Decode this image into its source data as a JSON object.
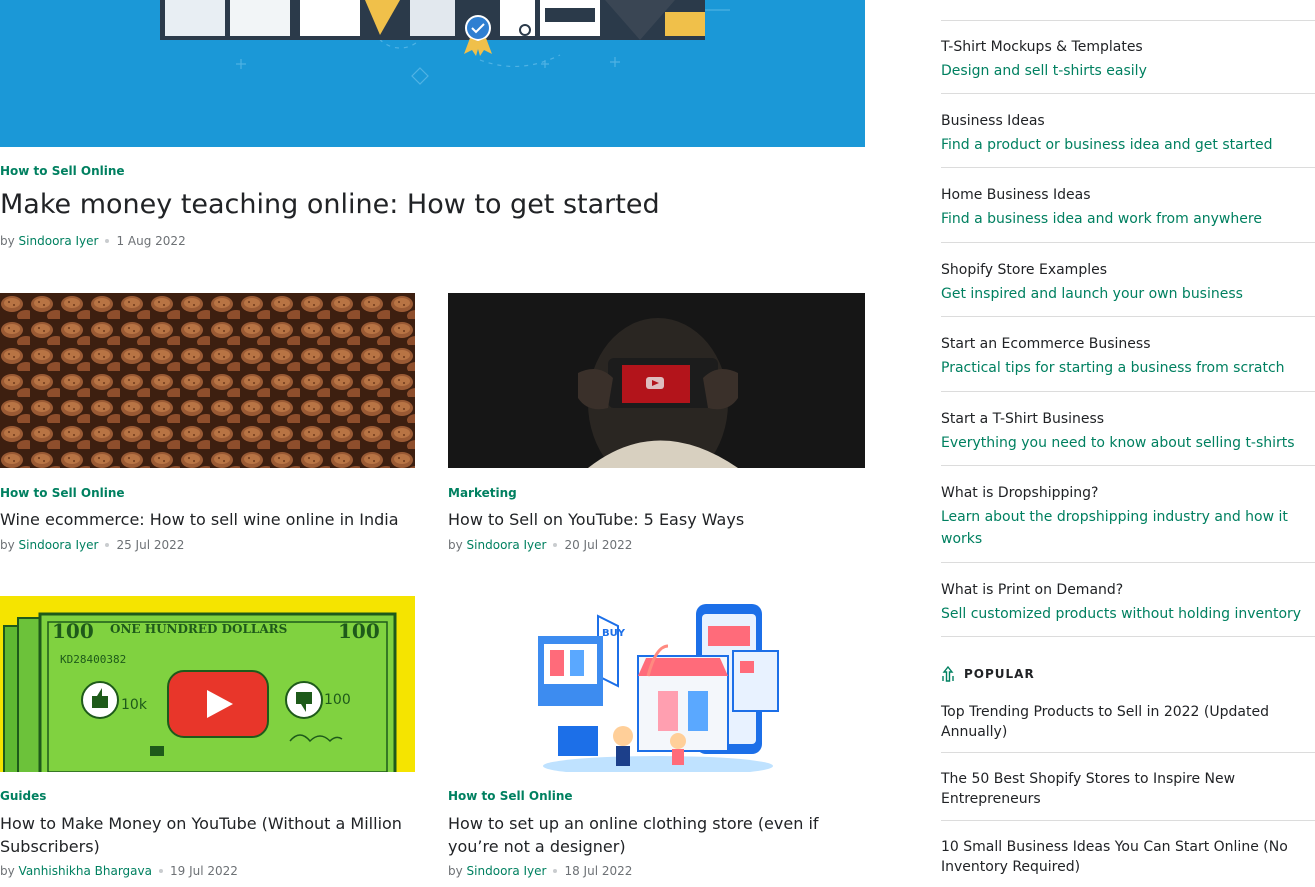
{
  "hero": {
    "category": "How to Sell Online",
    "title": "Make money teaching online: How to get started",
    "by": "by",
    "author": "Sindoora Iyer",
    "date": "1 Aug 2022"
  },
  "cards": [
    {
      "category": "How to Sell Online",
      "title": "Wine ecommerce: How to sell wine online in India",
      "by": "by",
      "author": "Sindoora Iyer",
      "date": "25 Jul 2022"
    },
    {
      "category": "Marketing",
      "title": "How to Sell on YouTube: 5 Easy Ways",
      "by": "by",
      "author": "Sindoora Iyer",
      "date": "20 Jul 2022"
    },
    {
      "category": "Guides",
      "title": "How to Make Money on YouTube (Without a Million Subscribers)",
      "by": "by",
      "author": "Vanhishikha Bhargava",
      "date": "19 Jul 2022"
    },
    {
      "category": "How to Sell Online",
      "title": "How to set up an online clothing store (even if you’re not a designer)",
      "by": "by",
      "author": "Sindoora Iyer",
      "date": "18 Jul 2022"
    }
  ],
  "money_art": {
    "banner": "ONE HUNDRED DOLLARS",
    "denom": "100",
    "serial": "KD28400382",
    "likes": "10k",
    "dislikes": "100",
    "buy": "BUY"
  },
  "sidebar": {
    "items": [
      {
        "title": "T-Shirt Mockups & Templates",
        "sub": "Design and sell t-shirts easily"
      },
      {
        "title": "Business Ideas",
        "sub": "Find a product or business idea and get started"
      },
      {
        "title": "Home Business Ideas",
        "sub": "Find a business idea and work from anywhere"
      },
      {
        "title": "Shopify Store Examples",
        "sub": "Get inspired and launch your own business"
      },
      {
        "title": "Start an Ecommerce Business",
        "sub": "Practical tips for starting a business from scratch"
      },
      {
        "title": "Start a T-Shirt Business",
        "sub": "Everything you need to know about selling t-shirts"
      },
      {
        "title": "What is Dropshipping?",
        "sub": "Learn about the dropshipping industry and how it works"
      },
      {
        "title": "What is Print on Demand?",
        "sub": "Sell customized products without holding inventory"
      }
    ],
    "popular_heading": "POPULAR",
    "popular": [
      {
        "title": "Top Trending Products to Sell in 2022 (Updated Annually)"
      },
      {
        "title": "The 50 Best Shopify Stores to Inspire New Entrepreneurs"
      },
      {
        "title": "10 Small Business Ideas You Can Start Online (No Inventory Required)"
      }
    ]
  },
  "colors": {
    "accent": "#008060",
    "hero_bg": "#1a9ad8",
    "money_bg": "#f5e400",
    "bill": "#7fd23f"
  }
}
